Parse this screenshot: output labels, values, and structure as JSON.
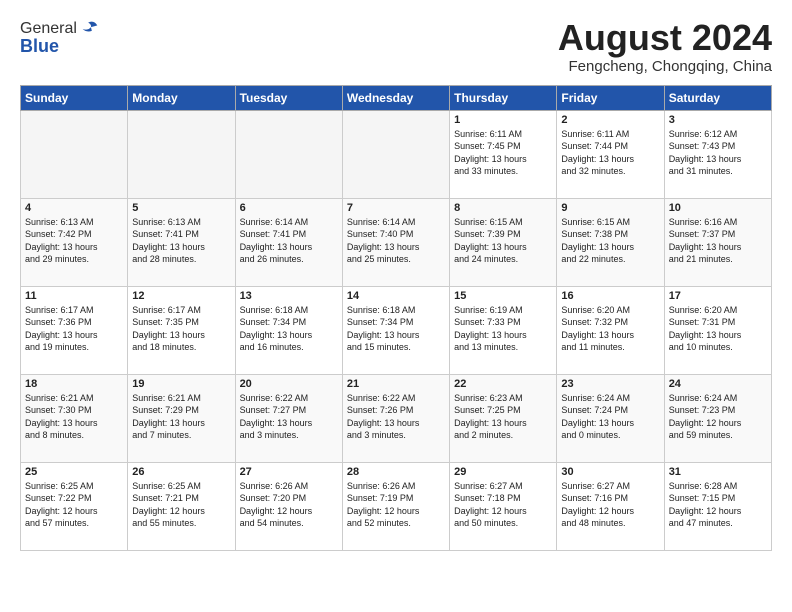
{
  "header": {
    "logo_general": "General",
    "logo_blue": "Blue",
    "month_year": "August 2024",
    "location": "Fengcheng, Chongqing, China"
  },
  "weekdays": [
    "Sunday",
    "Monday",
    "Tuesday",
    "Wednesday",
    "Thursday",
    "Friday",
    "Saturday"
  ],
  "weeks": [
    [
      {
        "day": "",
        "info": ""
      },
      {
        "day": "",
        "info": ""
      },
      {
        "day": "",
        "info": ""
      },
      {
        "day": "",
        "info": ""
      },
      {
        "day": "1",
        "info": "Sunrise: 6:11 AM\nSunset: 7:45 PM\nDaylight: 13 hours\nand 33 minutes."
      },
      {
        "day": "2",
        "info": "Sunrise: 6:11 AM\nSunset: 7:44 PM\nDaylight: 13 hours\nand 32 minutes."
      },
      {
        "day": "3",
        "info": "Sunrise: 6:12 AM\nSunset: 7:43 PM\nDaylight: 13 hours\nand 31 minutes."
      }
    ],
    [
      {
        "day": "4",
        "info": "Sunrise: 6:13 AM\nSunset: 7:42 PM\nDaylight: 13 hours\nand 29 minutes."
      },
      {
        "day": "5",
        "info": "Sunrise: 6:13 AM\nSunset: 7:41 PM\nDaylight: 13 hours\nand 28 minutes."
      },
      {
        "day": "6",
        "info": "Sunrise: 6:14 AM\nSunset: 7:41 PM\nDaylight: 13 hours\nand 26 minutes."
      },
      {
        "day": "7",
        "info": "Sunrise: 6:14 AM\nSunset: 7:40 PM\nDaylight: 13 hours\nand 25 minutes."
      },
      {
        "day": "8",
        "info": "Sunrise: 6:15 AM\nSunset: 7:39 PM\nDaylight: 13 hours\nand 24 minutes."
      },
      {
        "day": "9",
        "info": "Sunrise: 6:15 AM\nSunset: 7:38 PM\nDaylight: 13 hours\nand 22 minutes."
      },
      {
        "day": "10",
        "info": "Sunrise: 6:16 AM\nSunset: 7:37 PM\nDaylight: 13 hours\nand 21 minutes."
      }
    ],
    [
      {
        "day": "11",
        "info": "Sunrise: 6:17 AM\nSunset: 7:36 PM\nDaylight: 13 hours\nand 19 minutes."
      },
      {
        "day": "12",
        "info": "Sunrise: 6:17 AM\nSunset: 7:35 PM\nDaylight: 13 hours\nand 18 minutes."
      },
      {
        "day": "13",
        "info": "Sunrise: 6:18 AM\nSunset: 7:34 PM\nDaylight: 13 hours\nand 16 minutes."
      },
      {
        "day": "14",
        "info": "Sunrise: 6:18 AM\nSunset: 7:34 PM\nDaylight: 13 hours\nand 15 minutes."
      },
      {
        "day": "15",
        "info": "Sunrise: 6:19 AM\nSunset: 7:33 PM\nDaylight: 13 hours\nand 13 minutes."
      },
      {
        "day": "16",
        "info": "Sunrise: 6:20 AM\nSunset: 7:32 PM\nDaylight: 13 hours\nand 11 minutes."
      },
      {
        "day": "17",
        "info": "Sunrise: 6:20 AM\nSunset: 7:31 PM\nDaylight: 13 hours\nand 10 minutes."
      }
    ],
    [
      {
        "day": "18",
        "info": "Sunrise: 6:21 AM\nSunset: 7:30 PM\nDaylight: 13 hours\nand 8 minutes."
      },
      {
        "day": "19",
        "info": "Sunrise: 6:21 AM\nSunset: 7:29 PM\nDaylight: 13 hours\nand 7 minutes."
      },
      {
        "day": "20",
        "info": "Sunrise: 6:22 AM\nSunset: 7:27 PM\nDaylight: 13 hours\nand 3 minutes."
      },
      {
        "day": "21",
        "info": "Sunrise: 6:22 AM\nSunset: 7:26 PM\nDaylight: 13 hours\nand 3 minutes."
      },
      {
        "day": "22",
        "info": "Sunrise: 6:23 AM\nSunset: 7:25 PM\nDaylight: 13 hours\nand 2 minutes."
      },
      {
        "day": "23",
        "info": "Sunrise: 6:24 AM\nSunset: 7:24 PM\nDaylight: 13 hours\nand 0 minutes."
      },
      {
        "day": "24",
        "info": "Sunrise: 6:24 AM\nSunset: 7:23 PM\nDaylight: 12 hours\nand 59 minutes."
      }
    ],
    [
      {
        "day": "25",
        "info": "Sunrise: 6:25 AM\nSunset: 7:22 PM\nDaylight: 12 hours\nand 57 minutes."
      },
      {
        "day": "26",
        "info": "Sunrise: 6:25 AM\nSunset: 7:21 PM\nDaylight: 12 hours\nand 55 minutes."
      },
      {
        "day": "27",
        "info": "Sunrise: 6:26 AM\nSunset: 7:20 PM\nDaylight: 12 hours\nand 54 minutes."
      },
      {
        "day": "28",
        "info": "Sunrise: 6:26 AM\nSunset: 7:19 PM\nDaylight: 12 hours\nand 52 minutes."
      },
      {
        "day": "29",
        "info": "Sunrise: 6:27 AM\nSunset: 7:18 PM\nDaylight: 12 hours\nand 50 minutes."
      },
      {
        "day": "30",
        "info": "Sunrise: 6:27 AM\nSunset: 7:16 PM\nDaylight: 12 hours\nand 48 minutes."
      },
      {
        "day": "31",
        "info": "Sunrise: 6:28 AM\nSunset: 7:15 PM\nDaylight: 12 hours\nand 47 minutes."
      }
    ]
  ]
}
